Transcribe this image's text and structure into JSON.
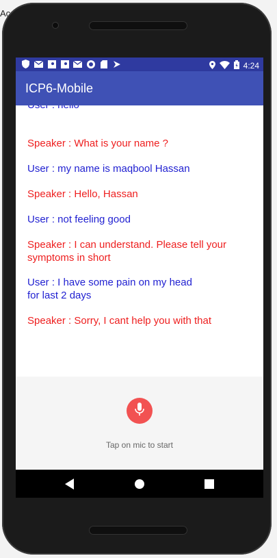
{
  "ide": {
    "title_fragment": "Ac"
  },
  "status_bar": {
    "time": "4:24",
    "left_icons": [
      "shield-icon",
      "mail-icon",
      "map-icon",
      "map-icon",
      "mail-icon",
      "circle-icon",
      "sd-card-icon",
      "assistant-icon"
    ],
    "right_icons": [
      "location-icon",
      "wifi-icon",
      "battery-icon"
    ]
  },
  "app": {
    "title": "ICP6-Mobile",
    "accent": "#3f51b5"
  },
  "chat": {
    "messages": [
      {
        "role": "user",
        "text": "User : hello"
      },
      {
        "role": "speaker",
        "text": "Speaker : What is your name ?"
      },
      {
        "role": "user",
        "text": "User : my name is maqbool Hassan"
      },
      {
        "role": "speaker",
        "text": "Speaker : Hello, Hassan"
      },
      {
        "role": "user",
        "text": "User : not feeling good"
      },
      {
        "role": "speaker",
        "text": "Speaker : I can understand. Please tell your symptoms in short"
      },
      {
        "role": "user",
        "text": "User : I have some pain on my head for last 2 days"
      },
      {
        "role": "speaker",
        "text": "Speaker : Sorry, I cant help you with that"
      }
    ],
    "colors": {
      "user": "#1f1fd1",
      "speaker": "#ee1e1e"
    }
  },
  "mic": {
    "hint": "Tap on mic to start",
    "button_color": "#f25252",
    "icon": "microphone-icon"
  },
  "nav": {
    "icons": [
      "back-icon",
      "home-icon",
      "recents-icon"
    ]
  }
}
